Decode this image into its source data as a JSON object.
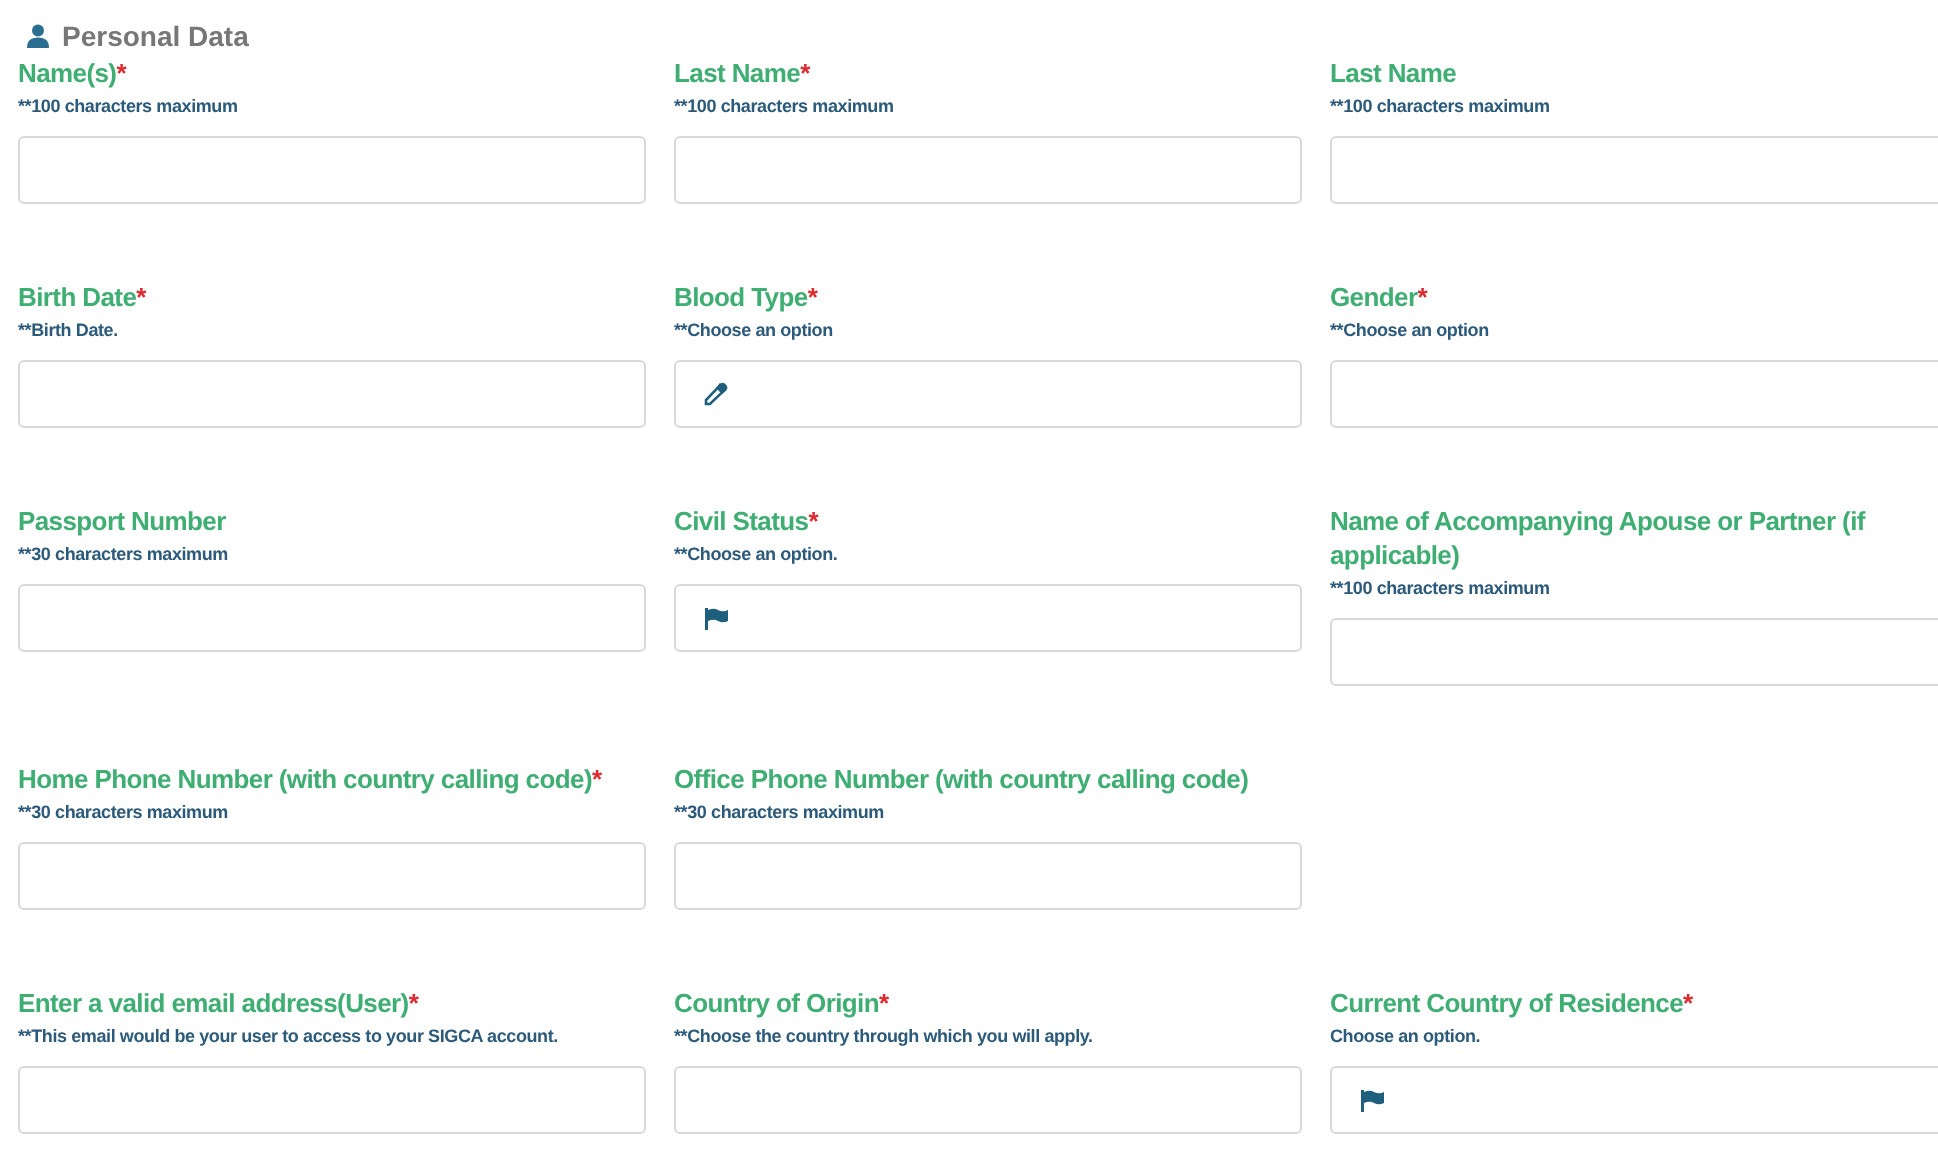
{
  "section": {
    "title": "Personal Data"
  },
  "rows": [
    [
      {
        "kind": "plain",
        "label": "Name(s)",
        "mark": "*",
        "hint": "**100 characters maximum"
      },
      {
        "kind": "plain",
        "label": "Last Name",
        "mark": "*",
        "hint": "**100 characters maximum"
      },
      {
        "kind": "plain",
        "label": "Last Name",
        "hint": "**100 characters maximum"
      }
    ],
    [
      {
        "kind": "plain",
        "label": "Birth Date",
        "mark": "*",
        "hint": "**Birth Date."
      },
      {
        "kind": "eyedropper",
        "label": "Blood Type",
        "mark": "*",
        "hint": "**Choose an option"
      },
      {
        "kind": "plain",
        "label": "Gender",
        "mark": "*",
        "hint": "**Choose an option"
      }
    ],
    [
      {
        "kind": "plain",
        "label": "Passport Number",
        "hint": "**30 characters maximum"
      },
      {
        "kind": "flag",
        "label": "Civil Status",
        "mark": "*",
        "hint": "**Choose an option."
      },
      {
        "kind": "plain",
        "label": "Name of Accompanying Apouse or Partner (if applicable)",
        "hint": "**100 characters maximum"
      }
    ],
    [
      {
        "kind": "plain",
        "label": "Home Phone Number (with country calling code)",
        "mark": "*",
        "hint": "**30 characters maximum"
      },
      {
        "kind": "plain",
        "label": "Office Phone Number (with country calling code)",
        "hint": "**30 characters maximum"
      }
    ],
    [
      {
        "kind": "plain",
        "label": "Enter a valid email address(User)",
        "mark": "*",
        "hint": "**This email would be your user to access to your SIGCA account."
      },
      {
        "kind": "plain",
        "label": "Country of Origin",
        "mark": "*",
        "hint": "**Choose the country through which you will apply."
      },
      {
        "kind": "flag",
        "label": "Current Country of Residence",
        "mark": "*",
        "hint": "Choose an option."
      }
    ]
  ]
}
